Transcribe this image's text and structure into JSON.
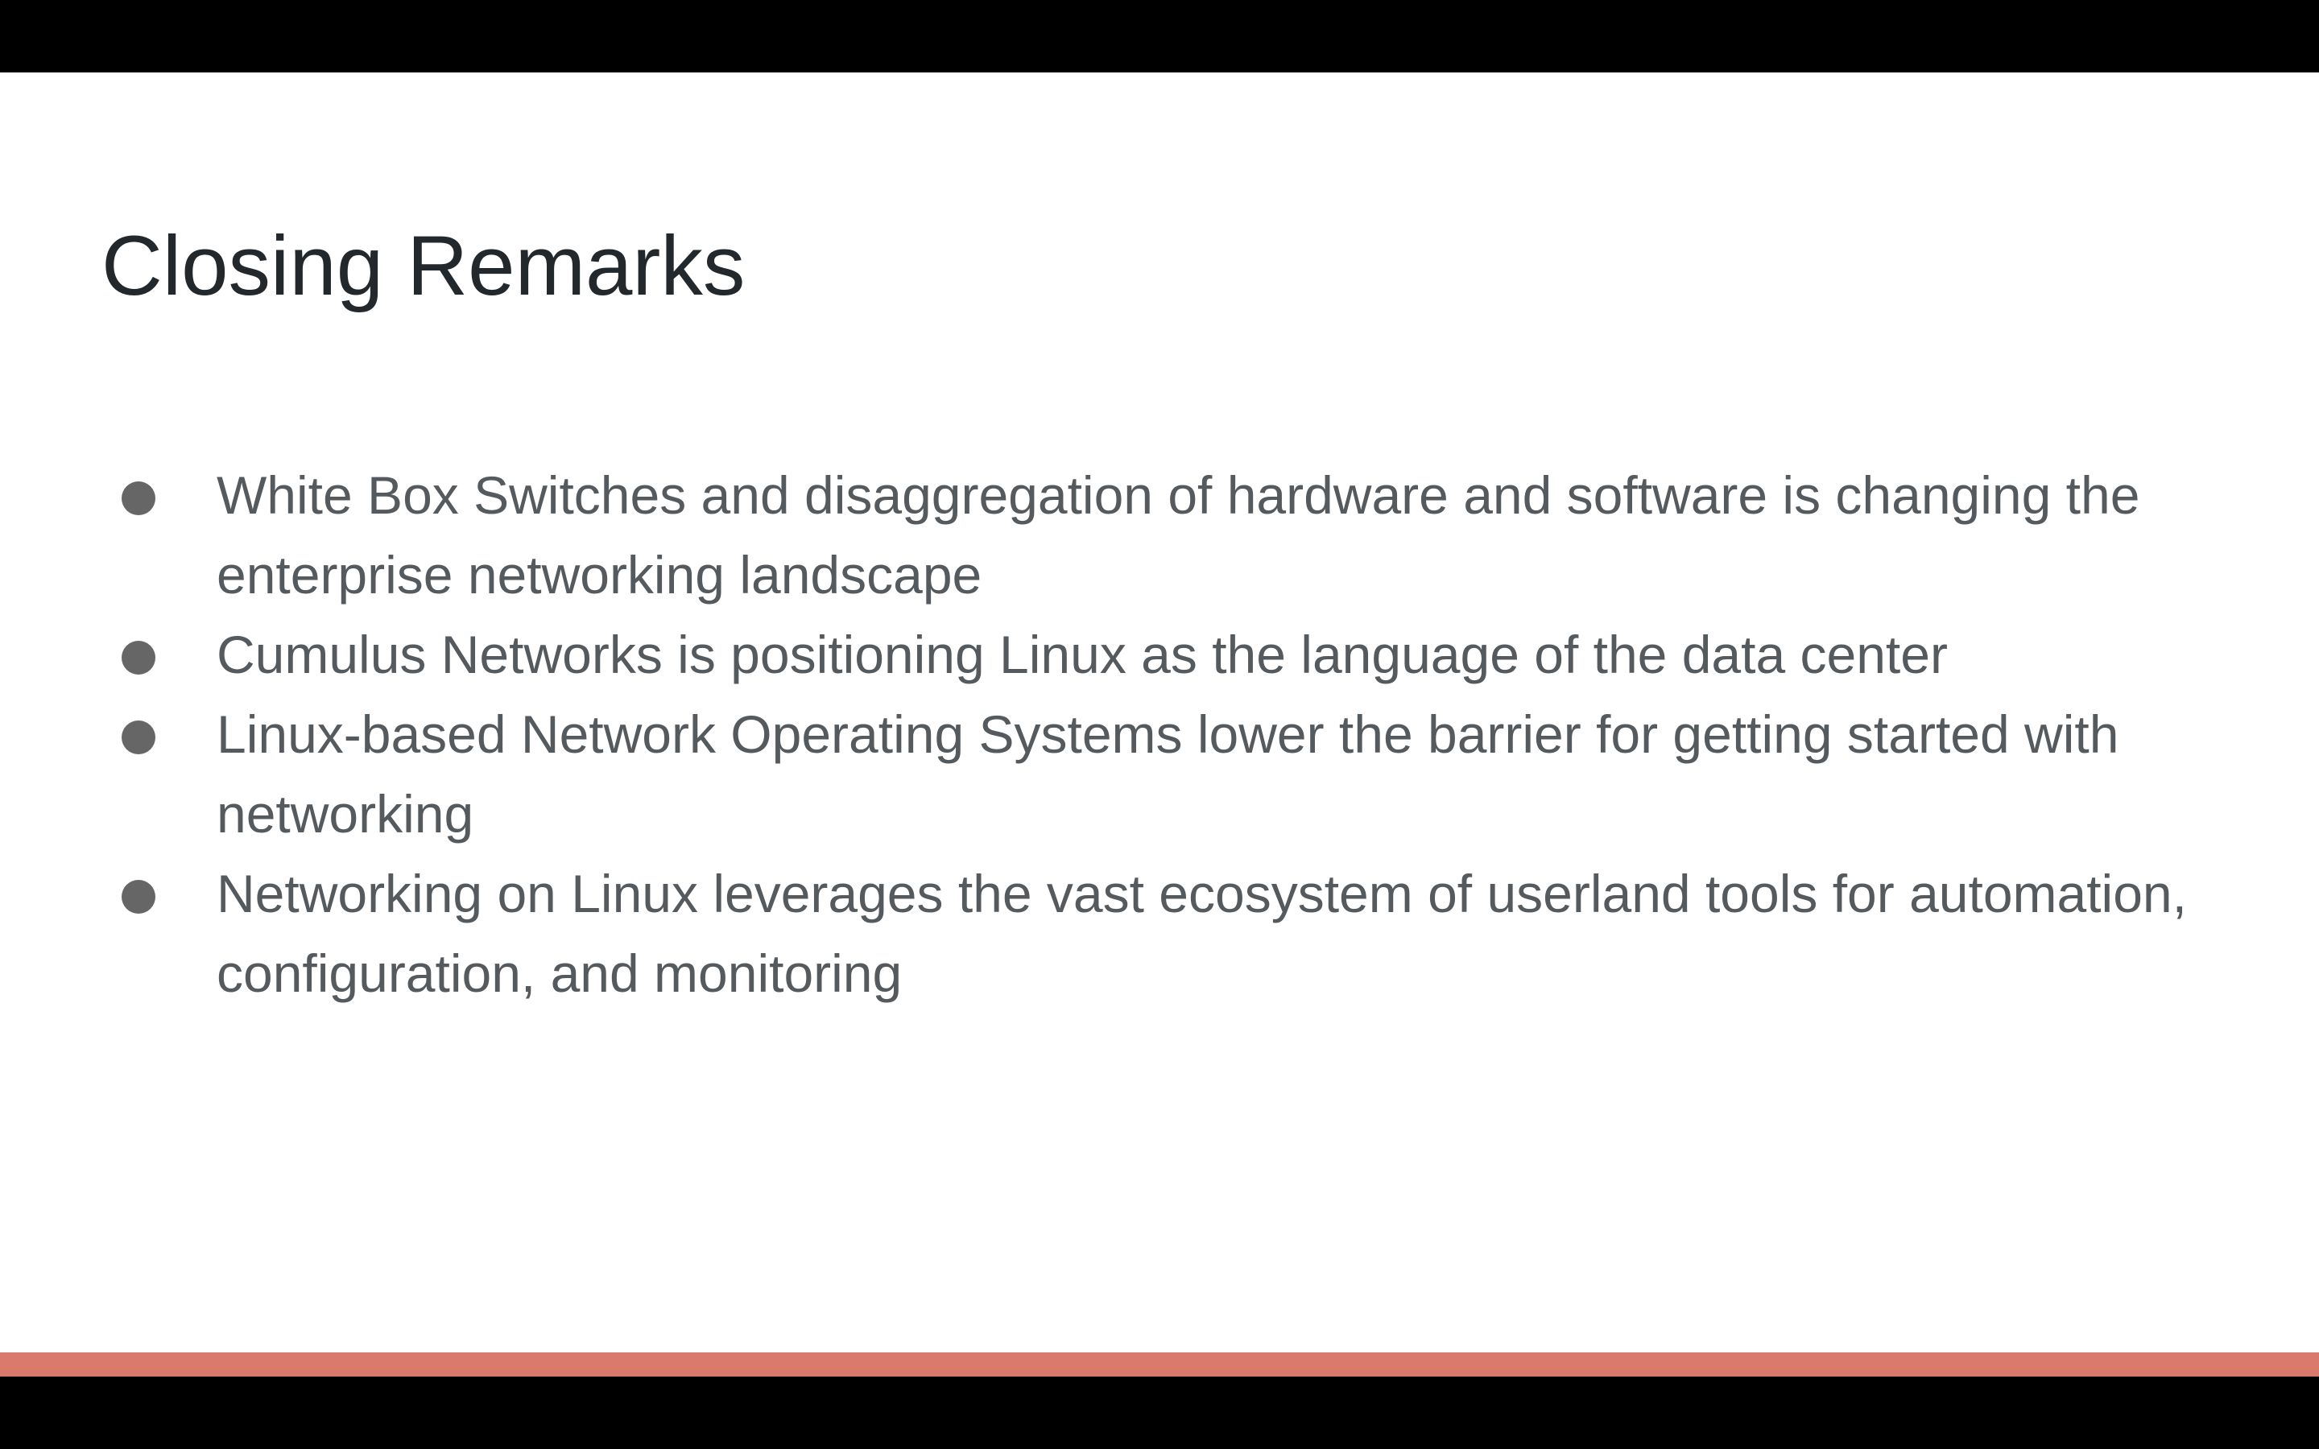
{
  "slide": {
    "title": "Closing Remarks",
    "bullets": [
      "White Box Switches and disaggregation of hardware and software is changing the enterprise networking landscape",
      "Cumulus Networks is positioning Linux as the language of the data center",
      "Linux-based Network Operating Systems lower the barrier for getting started with networking",
      "Networking on Linux leverages the vast ecosystem of userland tools for automation, configuration, and monitoring"
    ],
    "colors": {
      "title": "#22282c",
      "body_text": "#555a5e",
      "bullet": "#666666",
      "accent_bar": "#da7a6c",
      "letterbox": "#000000",
      "background": "#ffffff"
    }
  }
}
